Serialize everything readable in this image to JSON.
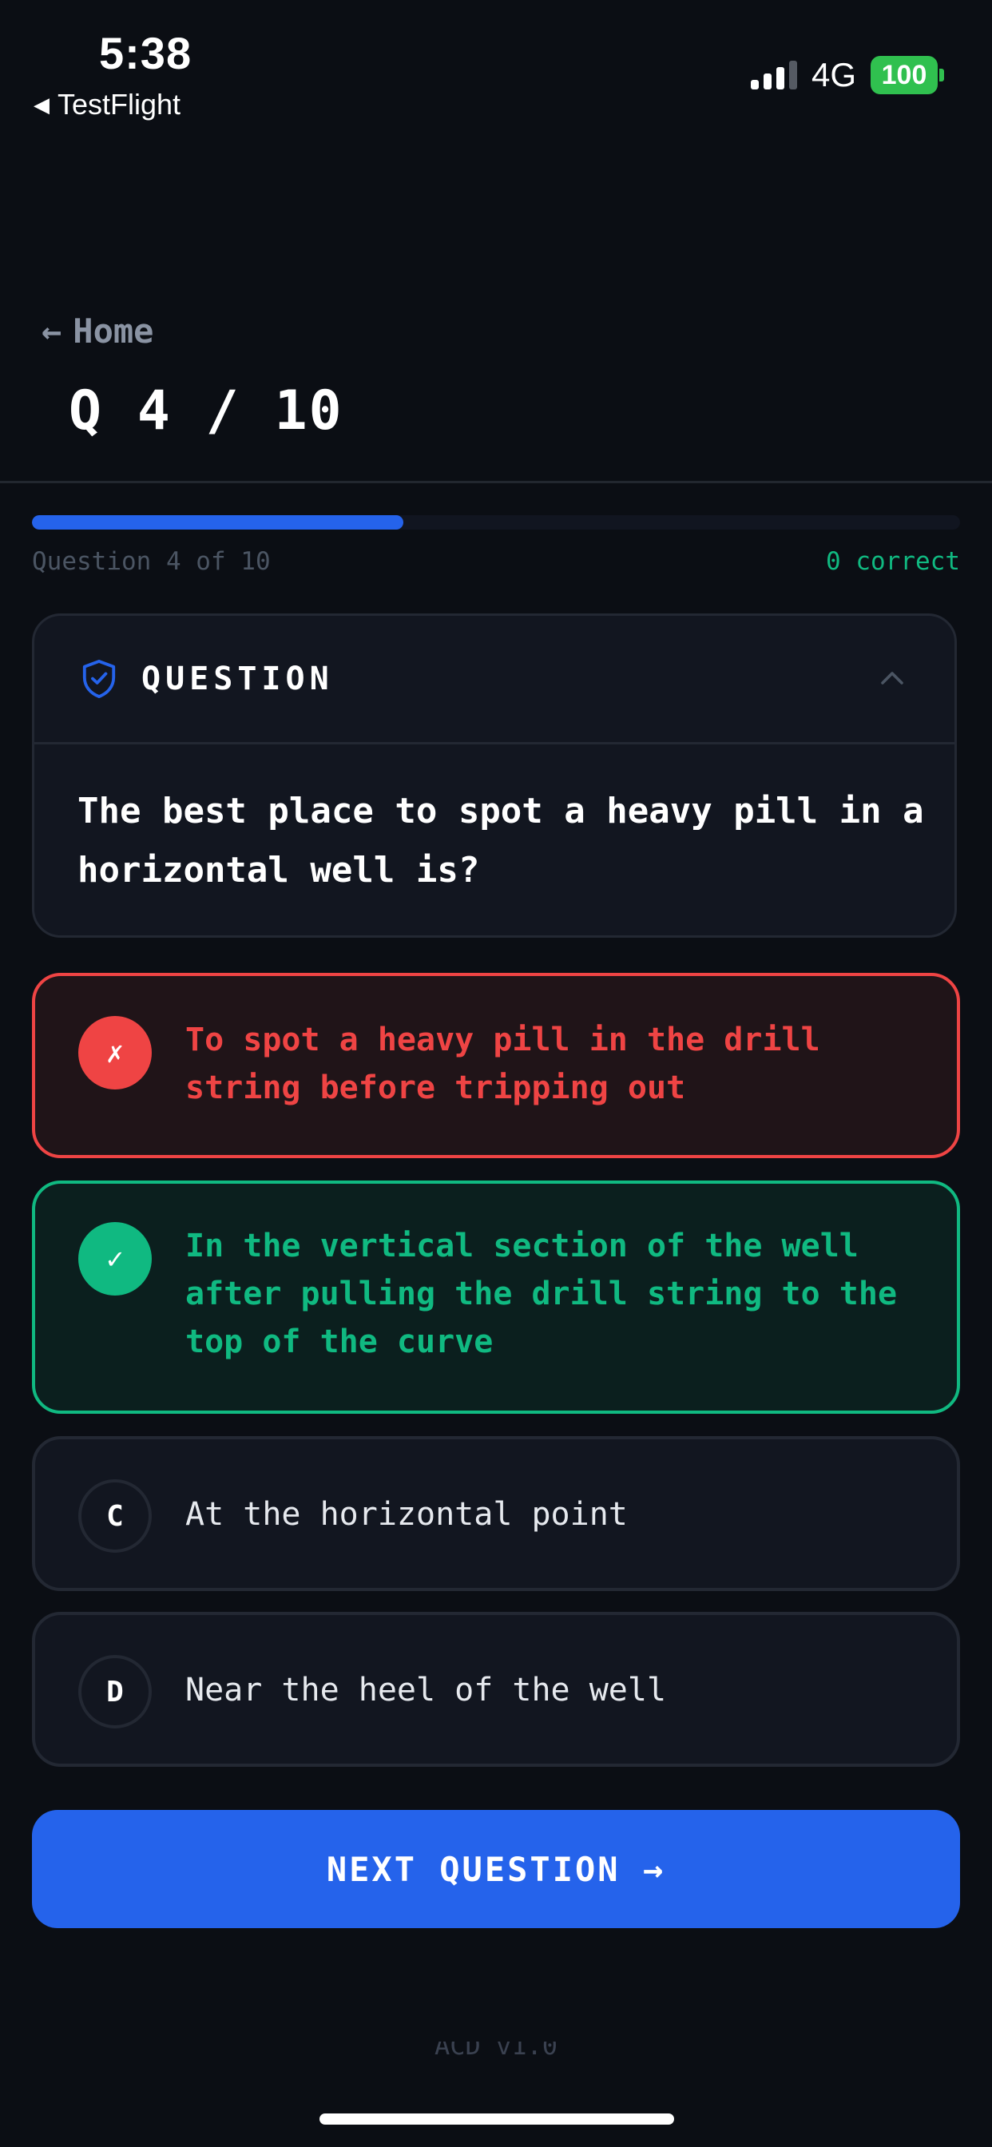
{
  "status_bar": {
    "time": "5:38",
    "back_app": "TestFlight",
    "network": "4G",
    "battery": "100"
  },
  "header": {
    "home_label": "Home",
    "question_counter": "Q 4 / 10"
  },
  "progress": {
    "fraction": 0.4,
    "label": "Question 4 of 10",
    "correct": "0 correct"
  },
  "question": {
    "section_label": "QUESTION",
    "text": "The best place to spot a heavy pill in a horizontal well is?"
  },
  "answers": [
    {
      "badge": "✗",
      "text": "To spot a heavy pill in the drill string before tripping out",
      "state": "incorrect"
    },
    {
      "badge": "✓",
      "text": "In the vertical section of the well after pulling the drill string to the top of the curve",
      "state": "correct"
    },
    {
      "badge": "C",
      "text": "At the horizontal point",
      "state": "neutral"
    },
    {
      "badge": "D",
      "text": "Near the heel of the well",
      "state": "neutral"
    }
  ],
  "next_button": "NEXT QUESTION →",
  "footer_text": "ACD v1.0",
  "colors": {
    "background": "#0b0e14",
    "accent": "#2563eb",
    "correct": "#10b981",
    "incorrect": "#ef4444"
  },
  "icons": {
    "question": "shield-check-icon",
    "collapse": "chevron-up-icon",
    "back": "arrow-left-icon"
  }
}
